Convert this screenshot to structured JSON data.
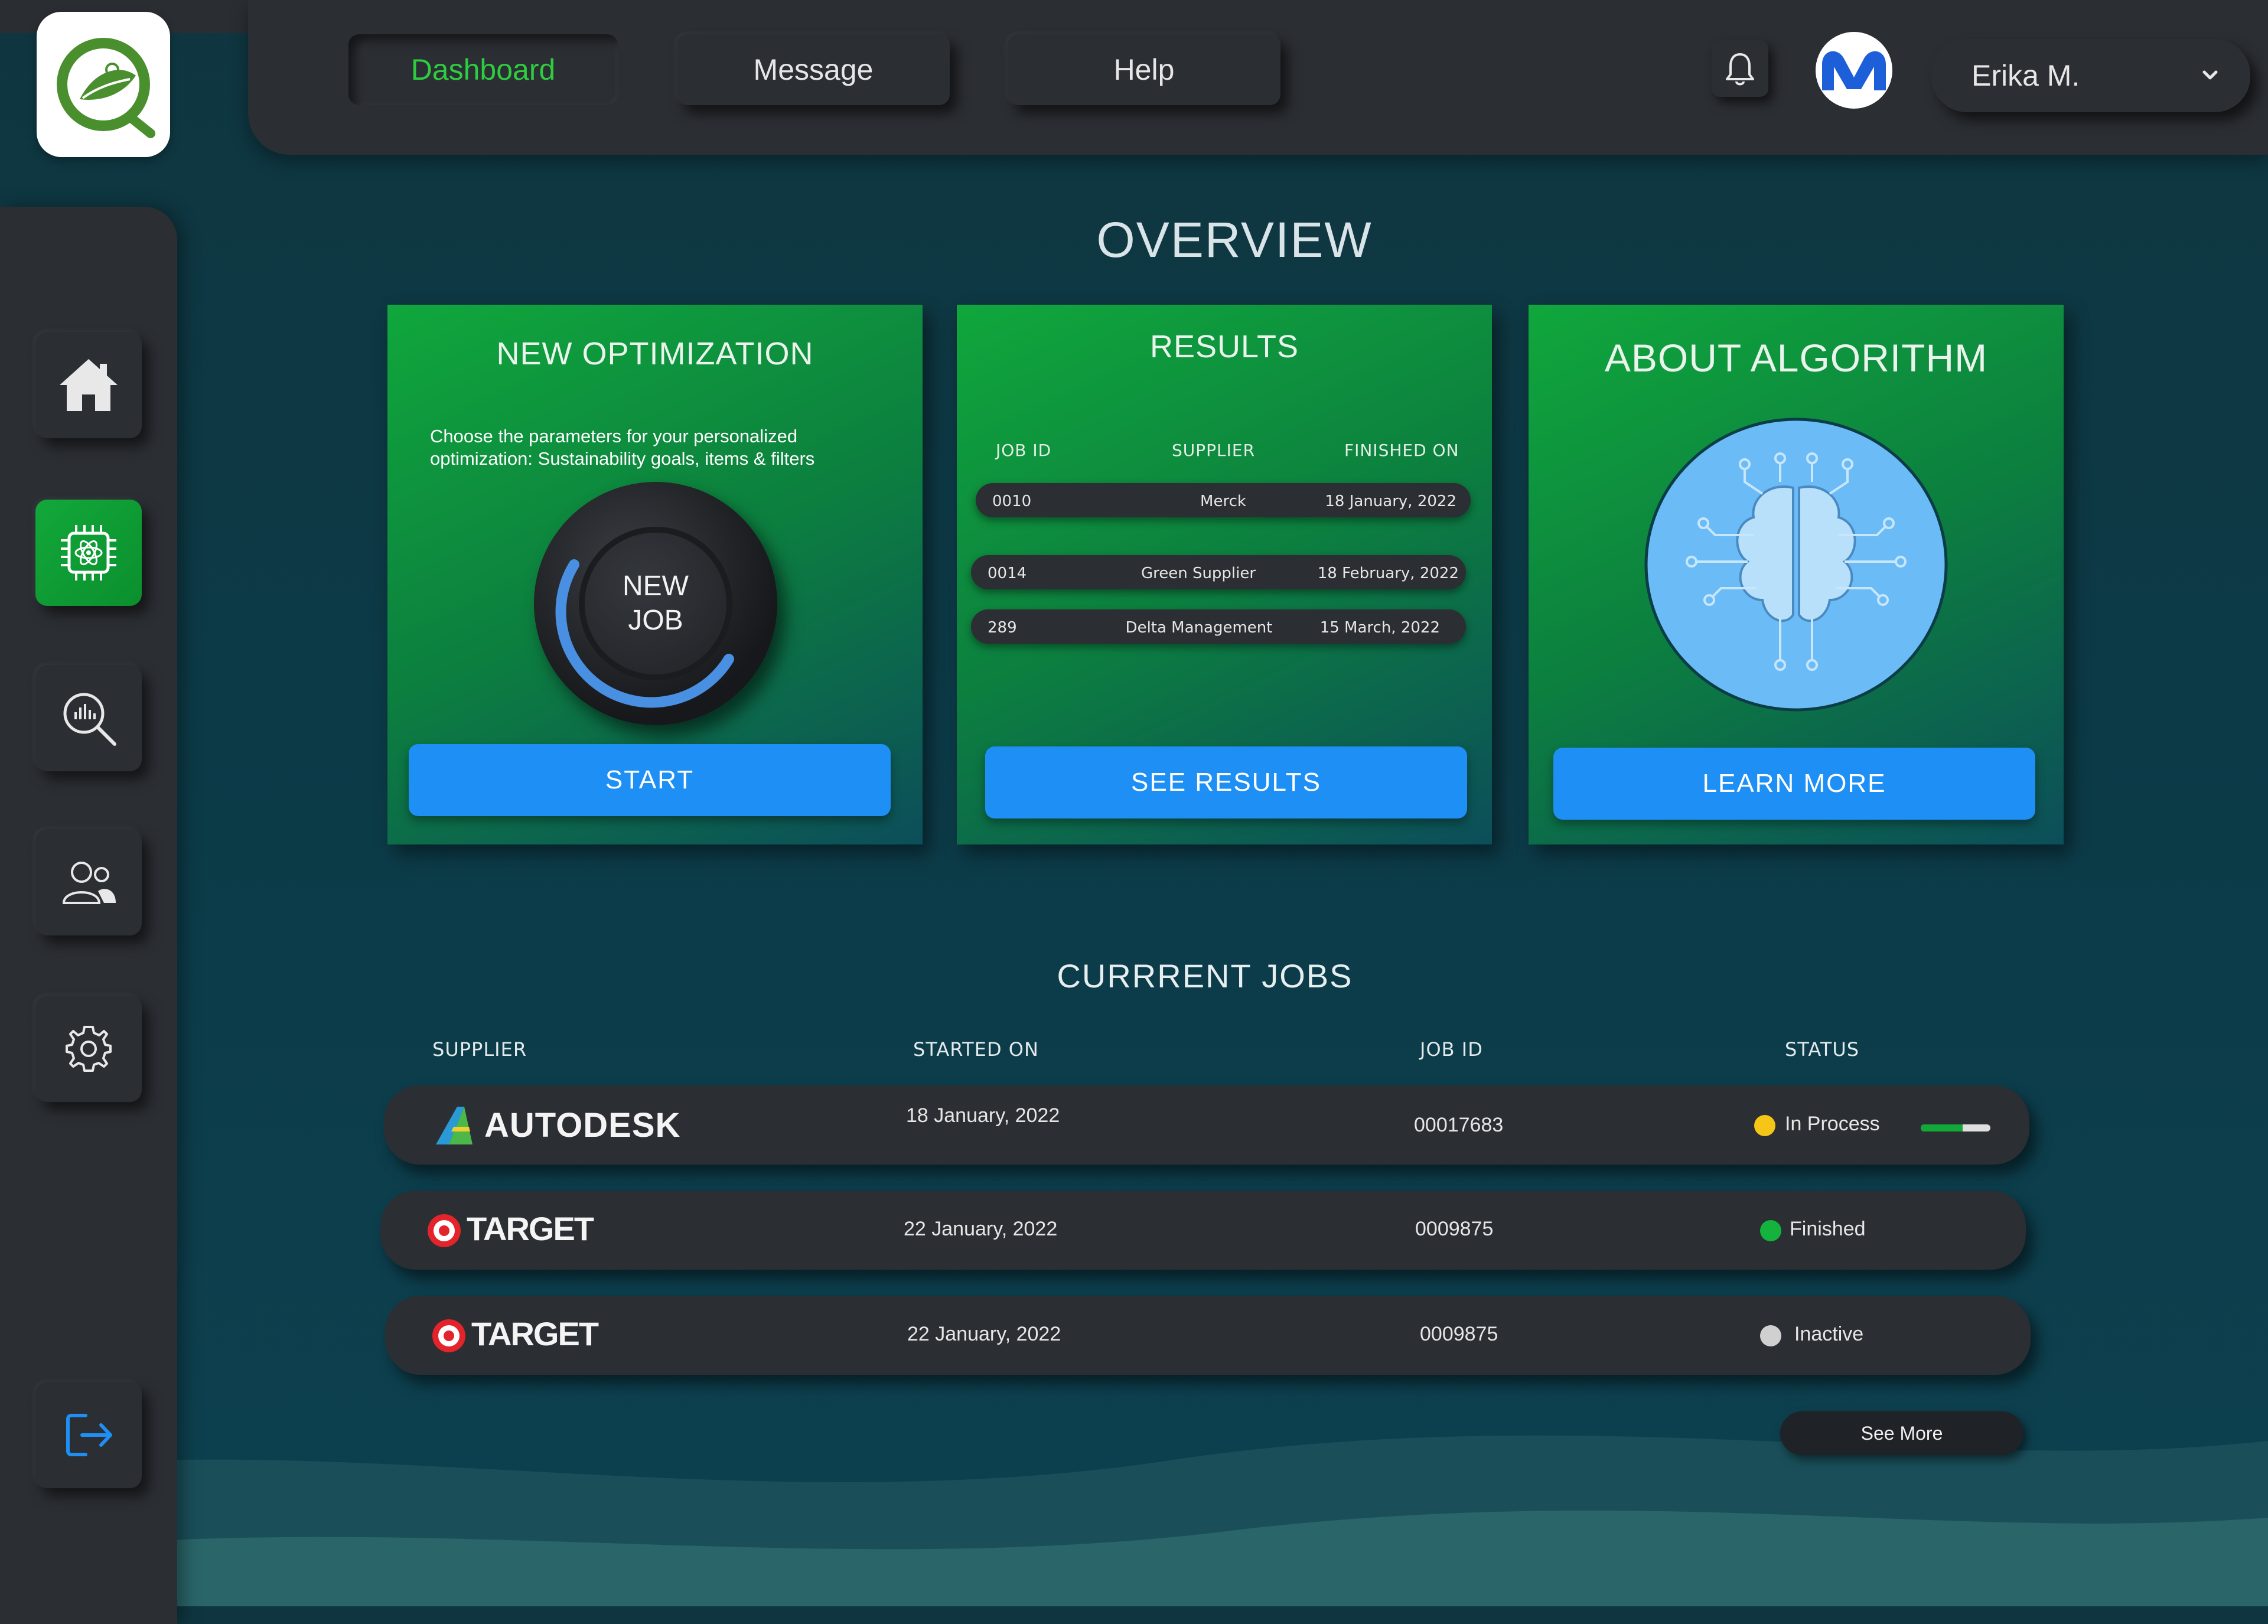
{
  "colors": {
    "accent_green": "#2ecc40",
    "primary_blue": "#1e8ff5",
    "surface": "#2b2e33",
    "background": "#0d3a46",
    "status_in_process": "#f5c518",
    "status_finished": "#14b33d",
    "status_inactive": "#d0d0d0"
  },
  "header": {
    "nav": [
      {
        "label": "Dashboard",
        "active": true
      },
      {
        "label": "Message",
        "active": false
      },
      {
        "label": "Help",
        "active": false
      }
    ],
    "notification_icon": "bell-icon",
    "avatar_icon": "m-logo",
    "user": {
      "name": "Erika M.",
      "dropdown_icon": "chevron-down-icon"
    }
  },
  "sidebar": {
    "items": [
      {
        "icon": "home-icon",
        "active": false
      },
      {
        "icon": "ai-chip-icon",
        "active": true
      },
      {
        "icon": "analytics-search-icon",
        "active": false
      },
      {
        "icon": "users-icon",
        "active": false
      },
      {
        "icon": "gear-icon",
        "active": false
      }
    ],
    "logout_icon": "logout-icon"
  },
  "overview": {
    "title": "OVERVIEW",
    "new_optimization": {
      "title": "NEW OPTIMIZATION",
      "description_line1": "Choose the parameters for your personalized",
      "description_line2": "optimization: Sustainability goals, items & filters",
      "dial_line1": "NEW",
      "dial_line2": "JOB",
      "button": "START"
    },
    "results": {
      "title": "RESULTS",
      "columns": [
        "JOB ID",
        "SUPPLIER",
        "FINISHED ON"
      ],
      "rows": [
        {
          "job_id": "0010",
          "supplier": "Merck",
          "finished_on": "18 January, 2022"
        },
        {
          "job_id": "0014",
          "supplier": "Green Supplier",
          "finished_on": "18 February, 2022"
        },
        {
          "job_id": "289",
          "supplier": "Delta Management",
          "finished_on": "15 March, 2022"
        }
      ],
      "button": "SEE RESULTS"
    },
    "about": {
      "title": "ABOUT ALGORITHM",
      "image_icon": "brain-circuit-icon",
      "button": "LEARN MORE"
    }
  },
  "current_jobs": {
    "title": "CURRRENT JOBS",
    "columns": [
      "SUPPLIER",
      "STARTED ON",
      "JOB ID",
      "STATUS"
    ],
    "rows": [
      {
        "supplier": "AUTODESK",
        "logo": "autodesk-logo",
        "started_on": "18 January, 2022",
        "job_id": "00017683",
        "status": "In Process",
        "status_color": "#f5c518",
        "progress": 0.6
      },
      {
        "supplier": "TARGET",
        "logo": "target-logo",
        "started_on": "22 January, 2022",
        "job_id": "0009875",
        "status": "Finished",
        "status_color": "#14b33d"
      },
      {
        "supplier": "TARGET",
        "logo": "target-logo",
        "started_on": "22 January, 2022",
        "job_id": "0009875",
        "status": "Inactive",
        "status_color": "#d0d0d0"
      }
    ],
    "see_more": "See More"
  }
}
